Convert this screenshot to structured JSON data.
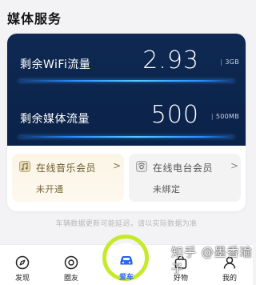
{
  "section": {
    "title": "媒体服务"
  },
  "wifi": {
    "label": "剩余WiFi流量",
    "value": "2.93",
    "unit": "3GB"
  },
  "media": {
    "label": "剩余媒体流量",
    "value": "500",
    "unit": "500MB"
  },
  "memberships": {
    "music": {
      "title": "在线音乐会员",
      "arrow": ">",
      "status": "未开通"
    },
    "radio": {
      "title": "在线电台会员",
      "arrow": ">",
      "status": "未绑定"
    }
  },
  "disclaimer": "车辆数据更新可能延迟，请以实际数据为准",
  "nav": {
    "discover": "发现",
    "circle": "圈友",
    "car": "爱车",
    "shop": "好物",
    "mine": "我的"
  },
  "watermark": "知乎 @墨香瑜子",
  "colors": {
    "panel_bg": "#0e2952",
    "accent_glow": "#2a8bff",
    "highlight_ring": "#c6ea2a",
    "active_nav": "#2a6bff"
  }
}
